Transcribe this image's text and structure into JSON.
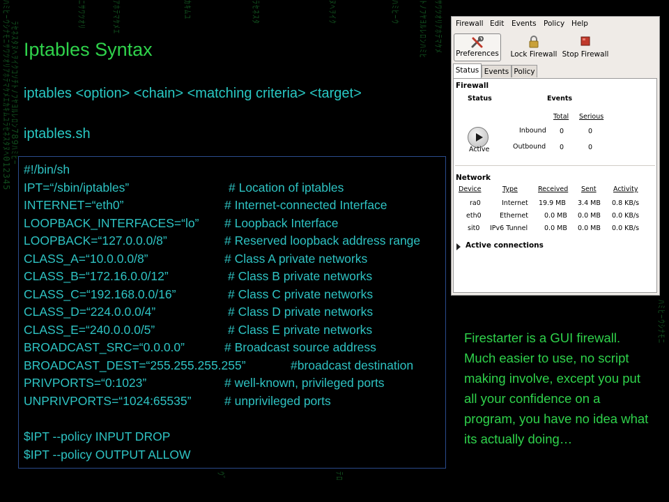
{
  "slide": {
    "title": "Iptables Syntax",
    "syntax_line": "iptables <option> <chain> <matching criteria> <target>",
    "script_name": "iptables.sh"
  },
  "script": {
    "lines": [
      {
        "code": "#!/bin/sh",
        "comment": ""
      },
      {
        "code": "IPT=“/sbin/iptables”",
        "comment": "# Location of iptables"
      },
      {
        "code": "INTERNET=“eth0”",
        "comment": "# Internet-connected  Interface"
      },
      {
        "code": "LOOPBACK_INTERFACES=“lo”",
        "comment": "# Loopback Interface"
      },
      {
        "code": "LOOPBACK=“127.0.0.0/8”",
        "comment": "# Reserved  loopback address range"
      },
      {
        "code": "CLASS_A=“10.0.0.0/8”",
        "comment": "# Class A private networks"
      },
      {
        "code": "CLASS_B=“172.16.0.0/12”",
        "comment": "# Class B private networks"
      },
      {
        "code": "CLASS_C=“192.168.0.0/16”",
        "comment": "# Class C private networks"
      },
      {
        "code": "CLASS_D=“224.0.0.0/4”",
        "comment": "# Class D private networks"
      },
      {
        "code": "CLASS_E=“240.0.0.0/5”",
        "comment": "# Class E private networks"
      },
      {
        "code": "BROADCAST_SRC=“0.0.0.0”",
        "comment": "# Broadcast source address"
      },
      {
        "code": "BROADCAST_DEST=“255.255.255.255”",
        "comment": "#broadcast destination"
      },
      {
        "code": "PRIVPORTS=“0:1023”",
        "comment": "# well-known, privileged ports"
      },
      {
        "code": "UNPRIVPORTS=“1024:65535”",
        "comment": "# unprivileged ports"
      },
      {
        "code": "",
        "comment": ""
      },
      {
        "code": "$IPT --policy INPUT DROP",
        "comment": ""
      },
      {
        "code": "$IPT --policy  OUTPUT ALLOW",
        "comment": ""
      }
    ]
  },
  "firewall": {
    "menu": [
      "Firewall",
      "Edit",
      "Events",
      "Policy",
      "Help"
    ],
    "toolbar": {
      "preferences": "Preferences",
      "lock": "Lock Firewall",
      "stop": "Stop Firewall"
    },
    "tabs": [
      "Status",
      "Events",
      "Policy"
    ],
    "status": {
      "section": "Firewall",
      "status_header": "Status",
      "events_header": "Events",
      "state": "Active",
      "col_total": "Total",
      "col_serious": "Serious",
      "rows": [
        {
          "label": "Inbound",
          "total": "0",
          "serious": "0"
        },
        {
          "label": "Outbound",
          "total": "0",
          "serious": "0"
        }
      ]
    },
    "network": {
      "section": "Network",
      "headers": [
        "Device",
        "Type",
        "Received",
        "Sent",
        "Activity"
      ],
      "rows": [
        {
          "device": "ra0",
          "type": "Internet",
          "received": "19.9 MB",
          "sent": "3.4 MB",
          "activity": "0.8 KB/s"
        },
        {
          "device": "eth0",
          "type": "Ethernet",
          "received": "0.0 MB",
          "sent": "0.0 MB",
          "activity": "0.0 KB/s"
        },
        {
          "device": "sit0",
          "type": "IPv6 Tunnel",
          "received": "0.0 MB",
          "sent": "0.0 MB",
          "activity": "0.0 KB/s"
        }
      ]
    },
    "active_connections": "Active connections"
  },
  "side_text": {
    "para1": "Firestarter is a GUI firewall.",
    "para2": "Much easier to use, no script making involve, except you put all your confidence on a program, you have no idea what its actually doing…"
  },
  "colors": {
    "title": "#2fd24b",
    "code": "#2ec3c3",
    "box_border": "#2b4c8e"
  }
}
